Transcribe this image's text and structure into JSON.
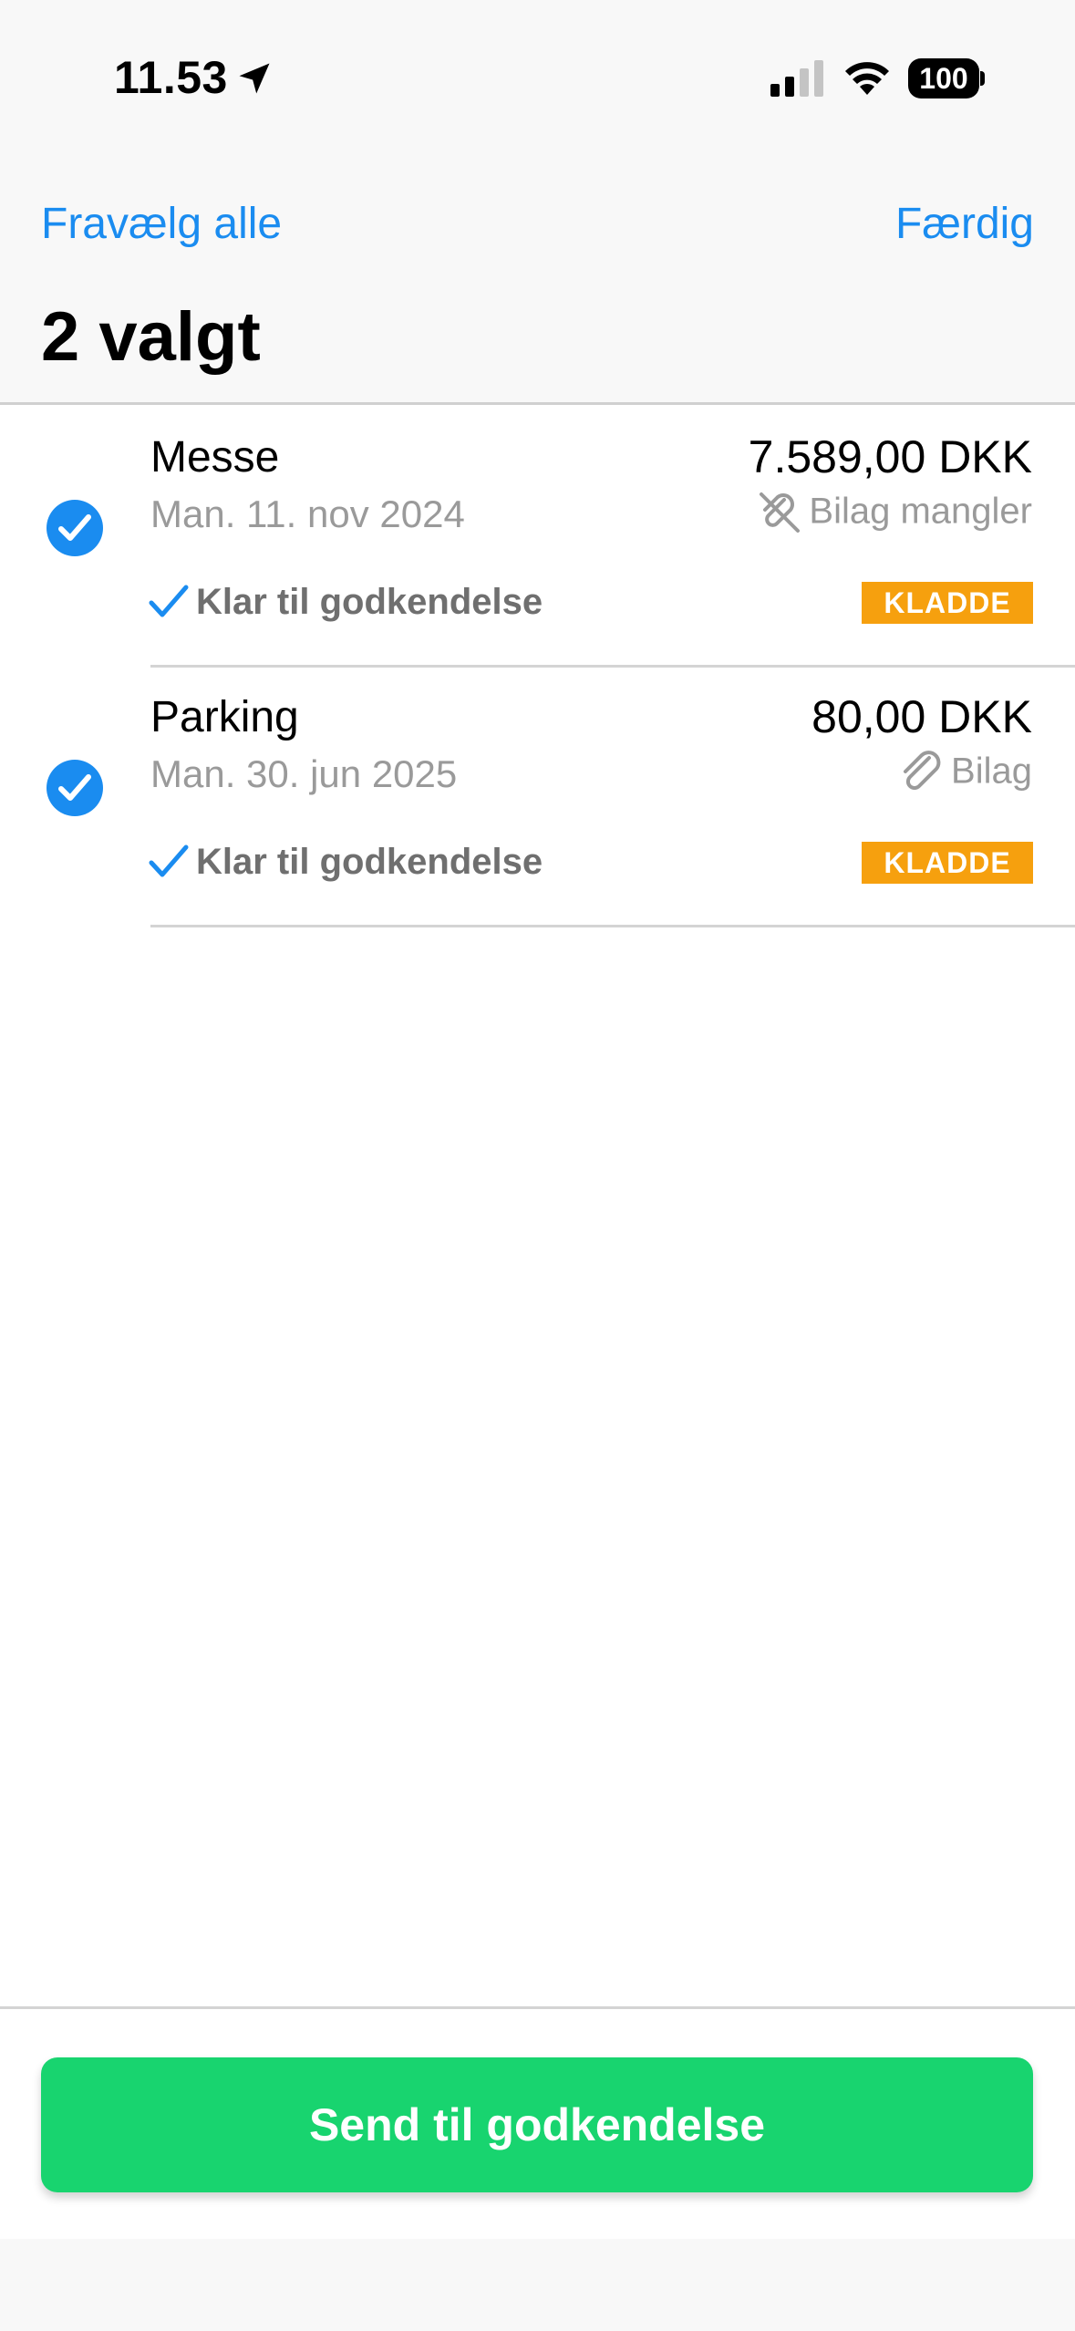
{
  "status_bar": {
    "time": "11.53",
    "battery": "100"
  },
  "nav": {
    "deselect_all": "Fravælg alle",
    "done": "Færdig"
  },
  "title": "2 valgt",
  "items": [
    {
      "title": "Messe",
      "date": "Man. 11. nov 2024",
      "amount": "7.589,00 DKK",
      "attachment": "Bilag mangler",
      "attachment_icon": "paperclip-slash-icon",
      "status": "Klar til godkendelse",
      "badge": "KLADDE",
      "selected": true
    },
    {
      "title": "Parking",
      "date": "Man. 30. jun 2025",
      "amount": "80,00 DKK",
      "attachment": "Bilag",
      "attachment_icon": "paperclip-icon",
      "status": "Klar til godkendelse",
      "badge": "KLADDE",
      "selected": true
    }
  ],
  "action_button": "Send til godkendelse",
  "colors": {
    "accent": "#1a8cf0",
    "badge": "#f6a00e",
    "button": "#18d46f"
  }
}
